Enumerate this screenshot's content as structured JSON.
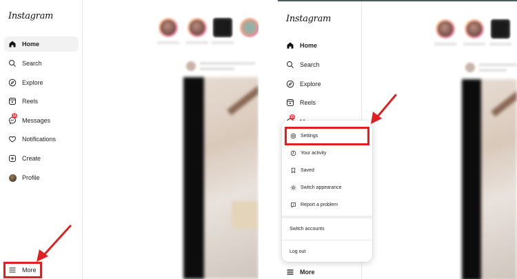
{
  "left_panel": {
    "logo": "Instagram",
    "nav": [
      {
        "label": "Home",
        "icon": "home-icon",
        "active": true
      },
      {
        "label": "Search",
        "icon": "search-icon"
      },
      {
        "label": "Explore",
        "icon": "compass-icon"
      },
      {
        "label": "Reels",
        "icon": "reels-icon"
      },
      {
        "label": "Messages",
        "icon": "messenger-icon",
        "badge": "11"
      },
      {
        "label": "Notifications",
        "icon": "heart-icon"
      },
      {
        "label": "Create",
        "icon": "plus-square-icon"
      },
      {
        "label": "Profile",
        "icon": "avatar-icon"
      }
    ],
    "more_label": "More"
  },
  "right_panel": {
    "logo": "Instagram",
    "nav": [
      {
        "label": "Home",
        "icon": "home-icon"
      },
      {
        "label": "Search",
        "icon": "search-icon"
      },
      {
        "label": "Explore",
        "icon": "compass-icon"
      },
      {
        "label": "Reels",
        "icon": "reels-icon"
      },
      {
        "label": "Messages",
        "icon": "messenger-icon",
        "badge": "11"
      }
    ],
    "more_menu": {
      "items": [
        {
          "label": "Settings",
          "icon": "gear-icon"
        },
        {
          "label": "Your activity",
          "icon": "activity-icon"
        },
        {
          "label": "Saved",
          "icon": "bookmark-icon"
        },
        {
          "label": "Switch appearance",
          "icon": "sun-icon"
        },
        {
          "label": "Report a problem",
          "icon": "report-icon"
        }
      ],
      "switch_accounts": "Switch accounts",
      "log_out": "Log out"
    },
    "more_label": "More"
  },
  "colors": {
    "highlight": "#e02020",
    "badge": "#ff3040",
    "active_bg": "#f2f2f2"
  }
}
